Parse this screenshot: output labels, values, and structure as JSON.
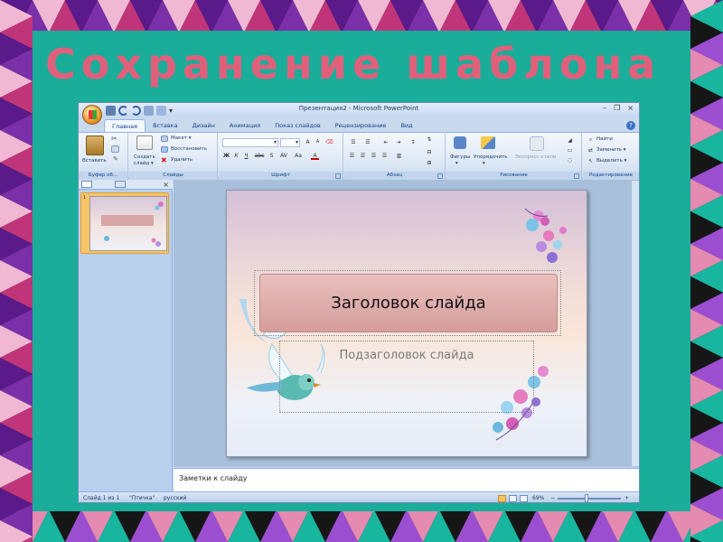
{
  "slide_title": "Сохранение шаблона",
  "window": {
    "title": "Презентация2 - Microsoft PowerPoint",
    "minimize": "–",
    "maximize": "❐",
    "close": "×"
  },
  "tabs": [
    {
      "label": "Главная"
    },
    {
      "label": "Вставка"
    },
    {
      "label": "Дизайн"
    },
    {
      "label": "Анимация"
    },
    {
      "label": "Показ слайдов"
    },
    {
      "label": "Рецензирование"
    },
    {
      "label": "Вид"
    }
  ],
  "ribbon": {
    "clipboard": {
      "paste": "Вставить",
      "label": "Буфер об..."
    },
    "slides": {
      "new_slide_1": "Создать",
      "new_slide_2": "слайд ▾",
      "layout": "Макет ▾",
      "reset": "Восстановить",
      "delete": "Удалить",
      "label": "Слайды"
    },
    "font": {
      "bold": "Ж",
      "italic": "К",
      "underline": "Ч",
      "strike": "abc",
      "shadow": "S",
      "spacing": "AV",
      "case": "Aa",
      "color": "A",
      "grow": "A",
      "shrink": "A",
      "label": "Шрифт"
    },
    "paragraph": {
      "label": "Абзац"
    },
    "drawing": {
      "shapes": "Фигуры",
      "arrange": "Упорядочить",
      "styles": "Экспресс-стили",
      "label": "Рисование"
    },
    "editing": {
      "find": "Найти",
      "replace": "Заменить ▾",
      "select": "Выделить ▾",
      "label": "Редактирование"
    }
  },
  "pane": {
    "thumb_num": "1",
    "close": "×"
  },
  "slide": {
    "title_placeholder": "Заголовок слайда",
    "subtitle_placeholder": "Подзаголовок слайда"
  },
  "notes_placeholder": "Заметки к слайду",
  "status": {
    "slide_of": "Слайд 1 из 1",
    "theme": "\"Птичка\"",
    "language": "русский",
    "zoom": "69%",
    "zoom_minus": "−",
    "zoom_plus": "+"
  },
  "colors": {
    "title_pink": "#e0607c",
    "teal": "#19ad9a",
    "triangle_palette": [
      "#5a1a8a",
      "#e58ab0",
      "#18b59f",
      "#7b2fa8",
      "#f0b8d3",
      "#161616",
      "#9b4fd0",
      "#c0357a"
    ]
  }
}
